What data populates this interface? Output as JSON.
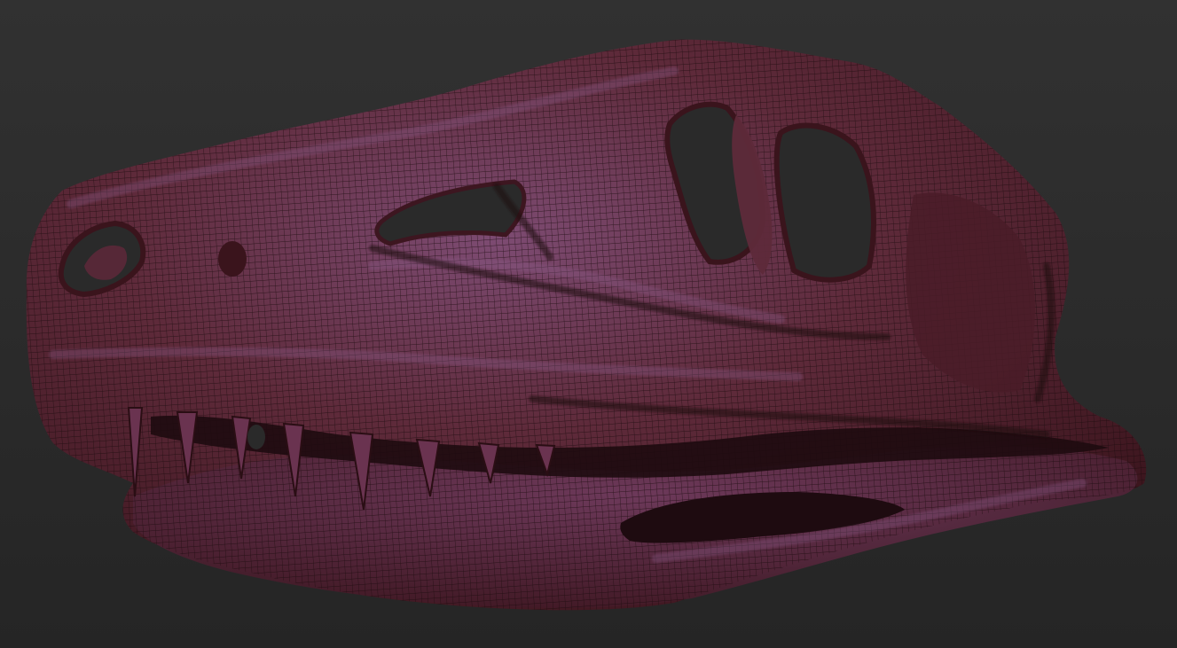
{
  "viewport": {
    "background_top": "#2f2f2f",
    "background_bottom": "#262626"
  },
  "model": {
    "subject": "dinosaur-skull-sculpt",
    "base_color": "#5a2430",
    "highlight_color": "#8a5a86",
    "shadow_color": "#1e0b10",
    "wire_color": "#1a0a0d",
    "fenestra_color": "#2a2a2a"
  }
}
